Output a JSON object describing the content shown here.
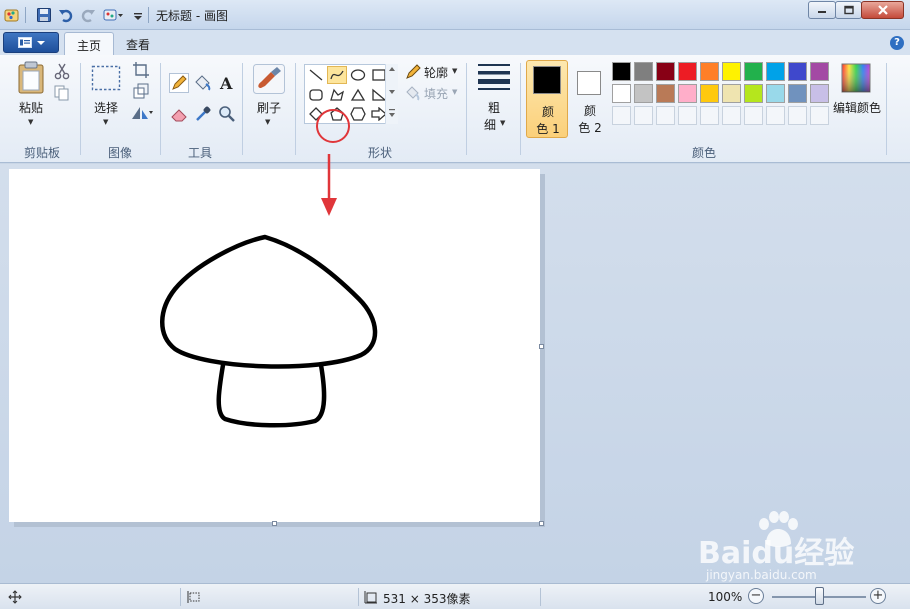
{
  "window": {
    "title": "无标题 - 画图",
    "controls": {
      "minimize": "minimize-icon",
      "maximize": "maximize-icon",
      "close": "close-icon"
    }
  },
  "quick_access": [
    "paint-app-icon",
    "save-icon",
    "undo-icon",
    "redo-icon",
    "customize-icon"
  ],
  "tabs": [
    {
      "label": "主页",
      "active": true
    },
    {
      "label": "查看",
      "active": false
    }
  ],
  "ribbon": {
    "clipboard": {
      "group_label": "剪贴板",
      "paste_label": "粘贴"
    },
    "image": {
      "group_label": "图像",
      "select_label": "选择"
    },
    "tools": {
      "group_label": "工具"
    },
    "brushes": {
      "label": "刷子"
    },
    "shapes": {
      "group_label": "形状",
      "outline_label": "轮廓",
      "fill_label": "填充"
    },
    "size": {
      "label_line1": "粗",
      "label_line2": "细"
    },
    "colors": {
      "group_label": "颜色",
      "color1_line1": "颜",
      "color1_line2": "色 1",
      "color2_line1": "颜",
      "color2_line2": "色 2",
      "edit_label": "编辑颜色",
      "color1": "#000000",
      "color2": "#ffffff",
      "palette_row1": [
        "#000000",
        "#7f7f7f",
        "#880015",
        "#ed1c24",
        "#ff7f27",
        "#fff200",
        "#22b14c",
        "#00a2e8",
        "#3f48cc",
        "#a349a4"
      ],
      "palette_row2": [
        "#ffffff",
        "#c3c3c3",
        "#b97a57",
        "#ffaec9",
        "#ffc90e",
        "#efe4b0",
        "#b5e61d",
        "#99d9ea",
        "#7092be",
        "#c8bfe7"
      ]
    }
  },
  "status": {
    "canvas_size": "531 × 353像素",
    "zoom": "100%",
    "zoom_level_fraction": 0.5
  },
  "watermark": {
    "brand": "Baidu经验",
    "url": "jingyan.baidu.com"
  },
  "accent": {
    "highlight": "#e0363a",
    "selected": "#fbd07a"
  }
}
